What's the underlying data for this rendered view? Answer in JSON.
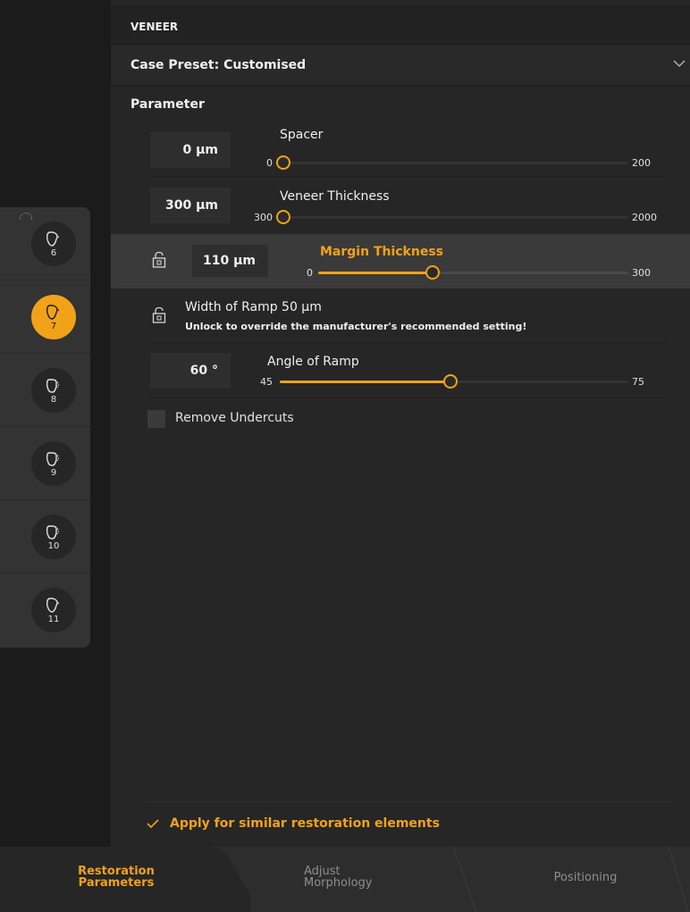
{
  "panel": {
    "section_title": "VENEER",
    "case_preset": "Case Preset: Customised",
    "parameter_heading": "Parameter"
  },
  "sliders": {
    "spacer": {
      "label": "Spacer",
      "value_text": "0 µm",
      "min": "0",
      "max": "200",
      "value": 0
    },
    "veneer_thickness": {
      "label": "Veneer Thickness",
      "value_text": "300 µm",
      "min": "300",
      "max": "2000",
      "value": 300
    },
    "margin_thickness": {
      "label": "Margin Thickness",
      "value_text": "110 µm",
      "min": "0",
      "max": "300",
      "value": 110
    },
    "angle_of_ramp": {
      "label": "Angle of Ramp",
      "value_text": "60 °",
      "min": "45",
      "max": "75",
      "value": 60
    }
  },
  "ramp": {
    "width_label": "Width of Ramp  50 µm",
    "note": "Unlock to override the manufacturer's recommended setting!"
  },
  "options": {
    "remove_undercuts": "Remove Undercuts",
    "apply_similar": "Apply for similar restoration elements"
  },
  "teeth": [
    {
      "number": "6",
      "active": false
    },
    {
      "number": "7",
      "active": true
    },
    {
      "number": "8",
      "active": false
    },
    {
      "number": "9",
      "active": false
    },
    {
      "number": "10",
      "active": false
    },
    {
      "number": "11",
      "active": false
    }
  ],
  "tabs": [
    {
      "label_line1": "Restoration",
      "label_line2": "Parameters",
      "active": true
    },
    {
      "label_line1": "Adjust",
      "label_line2": "Morphology",
      "active": false
    },
    {
      "label_line1": "Positioning",
      "label_line2": "",
      "active": false
    }
  ],
  "colors": {
    "accent": "#f2a219",
    "panel_bg": "#262626",
    "highlight_row": "#3a3a3a"
  }
}
